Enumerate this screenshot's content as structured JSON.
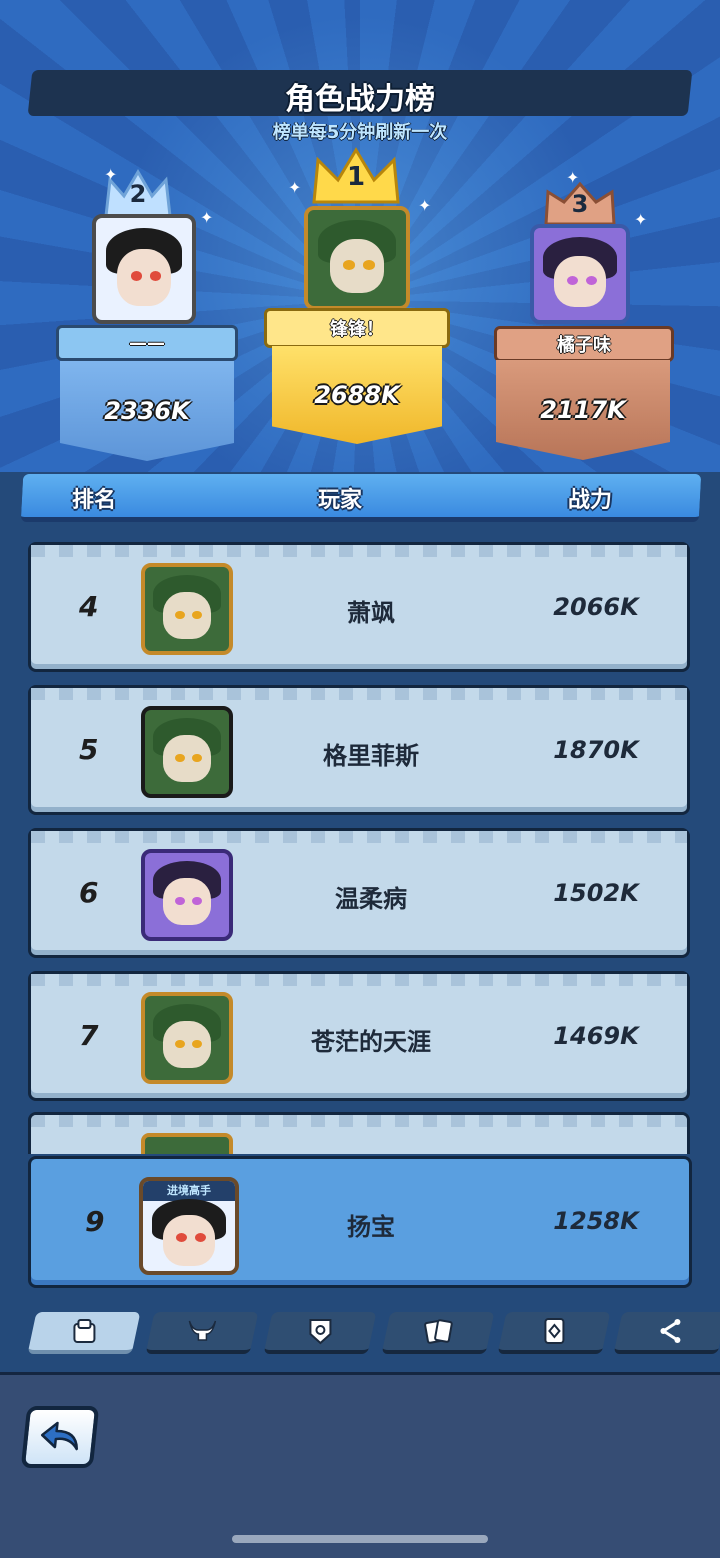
{
  "header": {
    "title": "角色战力榜",
    "subtitle": "榜单每5分钟刷新一次"
  },
  "podium": {
    "first": {
      "rank": "1",
      "name": "锋锋！",
      "power": "2688K"
    },
    "second": {
      "rank": "2",
      "name": "——",
      "power": "2336K"
    },
    "third": {
      "rank": "3",
      "name": "橘子味",
      "power": "2117K"
    }
  },
  "table": {
    "columns": [
      "排名",
      "玩家",
      "战力"
    ],
    "rows": [
      {
        "rank": "4",
        "name": "萧飒",
        "power": "2066K"
      },
      {
        "rank": "5",
        "name": "格里菲斯",
        "power": "1870K"
      },
      {
        "rank": "6",
        "name": "温柔病",
        "power": "1502K"
      },
      {
        "rank": "7",
        "name": "苍茫的天涯",
        "power": "1469K"
      }
    ]
  },
  "self_row": {
    "rank": "9",
    "name": "扬宝",
    "power": "1258K",
    "badge_text": "进境高手"
  },
  "tabs": [
    {
      "icon": "character-icon",
      "active": true
    },
    {
      "icon": "bull-horns-icon",
      "active": false
    },
    {
      "icon": "shield-badge-icon",
      "active": false
    },
    {
      "icon": "cards-icon",
      "active": false
    },
    {
      "icon": "card-emblem-icon",
      "active": false
    },
    {
      "icon": "share-network-icon",
      "active": false
    }
  ],
  "footer": {
    "back_icon": "back-arrow-icon"
  },
  "colors": {
    "gold": "#f5c842",
    "silver_blue": "#7fb5ee",
    "bronze": "#c98a6a",
    "row_bg": "#c3d9ea",
    "self_row_bg": "#5a9fe0"
  }
}
